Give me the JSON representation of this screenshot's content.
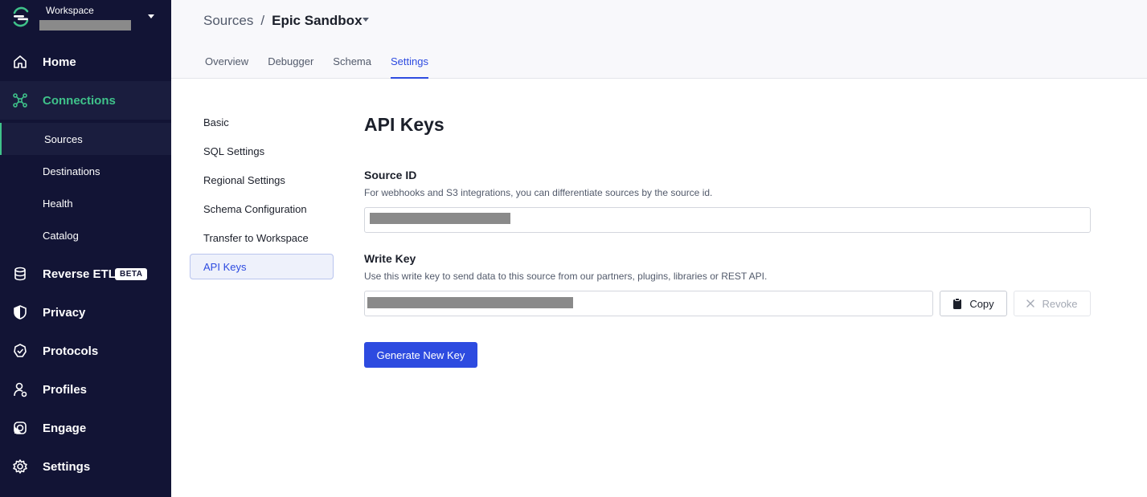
{
  "workspace": {
    "label": "Workspace",
    "logo_icon": "segment-logo-icon"
  },
  "sidebar": {
    "items": [
      {
        "label": "Home",
        "icon": "home-icon"
      },
      {
        "label": "Connections",
        "icon": "connections-icon",
        "active": true
      },
      {
        "label": "Reverse ETL",
        "icon": "database-icon",
        "badge": "BETA"
      },
      {
        "label": "Privacy",
        "icon": "shield-icon"
      },
      {
        "label": "Protocols",
        "icon": "protocols-icon"
      },
      {
        "label": "Profiles",
        "icon": "profiles-icon"
      },
      {
        "label": "Engage",
        "icon": "engage-icon"
      },
      {
        "label": "Settings",
        "icon": "gear-icon"
      }
    ],
    "sub_items": [
      {
        "label": "Sources",
        "active": true
      },
      {
        "label": "Destinations"
      },
      {
        "label": "Health"
      },
      {
        "label": "Catalog"
      }
    ]
  },
  "breadcrumb": {
    "parent": "Sources",
    "separator": "/",
    "current": "Epic Sandbox"
  },
  "tabs": [
    {
      "label": "Overview"
    },
    {
      "label": "Debugger"
    },
    {
      "label": "Schema"
    },
    {
      "label": "Settings",
      "active": true
    }
  ],
  "settings_menu": [
    {
      "label": "Basic"
    },
    {
      "label": "SQL Settings"
    },
    {
      "label": "Regional Settings"
    },
    {
      "label": "Schema Configuration"
    },
    {
      "label": "Transfer to Workspace"
    },
    {
      "label": "API Keys",
      "active": true
    }
  ],
  "main": {
    "title": "API Keys",
    "source_id": {
      "label": "Source ID",
      "help": "For webhooks and S3 integrations, you can differentiate sources by the source id."
    },
    "write_key": {
      "label": "Write Key",
      "help": "Use this write key to send data to this source from our partners, plugins, libraries or REST API."
    },
    "copy_label": "Copy",
    "revoke_label": "Revoke",
    "generate_label": "Generate New Key"
  },
  "colors": {
    "sidebar_bg": "#121435",
    "accent_green": "#3fc28a",
    "primary_blue": "#2d4be0"
  }
}
